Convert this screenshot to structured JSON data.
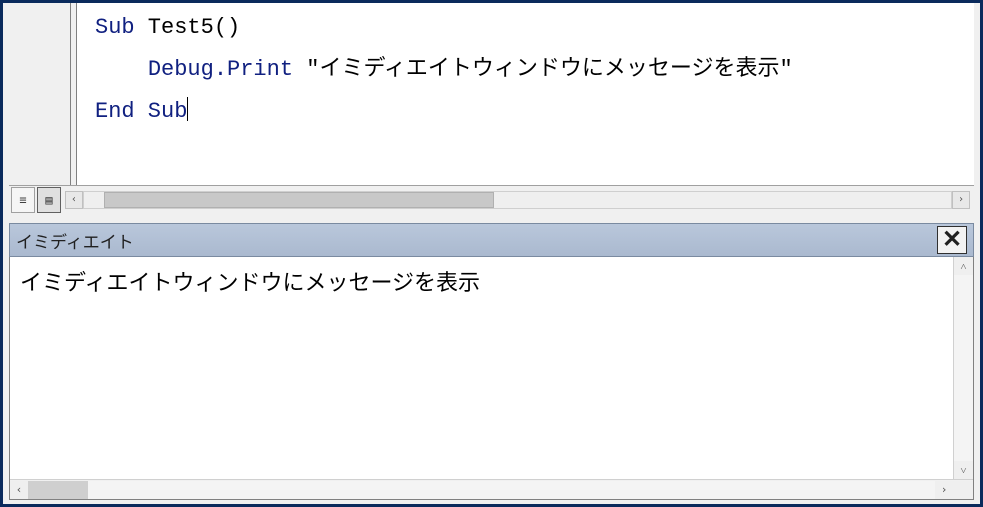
{
  "code": {
    "sub_kw": "Sub",
    "sub_name": " Test5()",
    "debug_print": "Debug.Print",
    "string_literal": " \"イミディエイトウィンドウにメッセージを表示\"",
    "end_kw": "End Sub"
  },
  "view_buttons": {
    "procedure": "≡",
    "full": "▤"
  },
  "immediate": {
    "title": "イミディエイト",
    "close": "✕",
    "output": "イミディエイトウィンドウにメッセージを表示"
  },
  "scroll": {
    "left": "‹",
    "right": "›",
    "up": "˄",
    "down": "˅"
  }
}
